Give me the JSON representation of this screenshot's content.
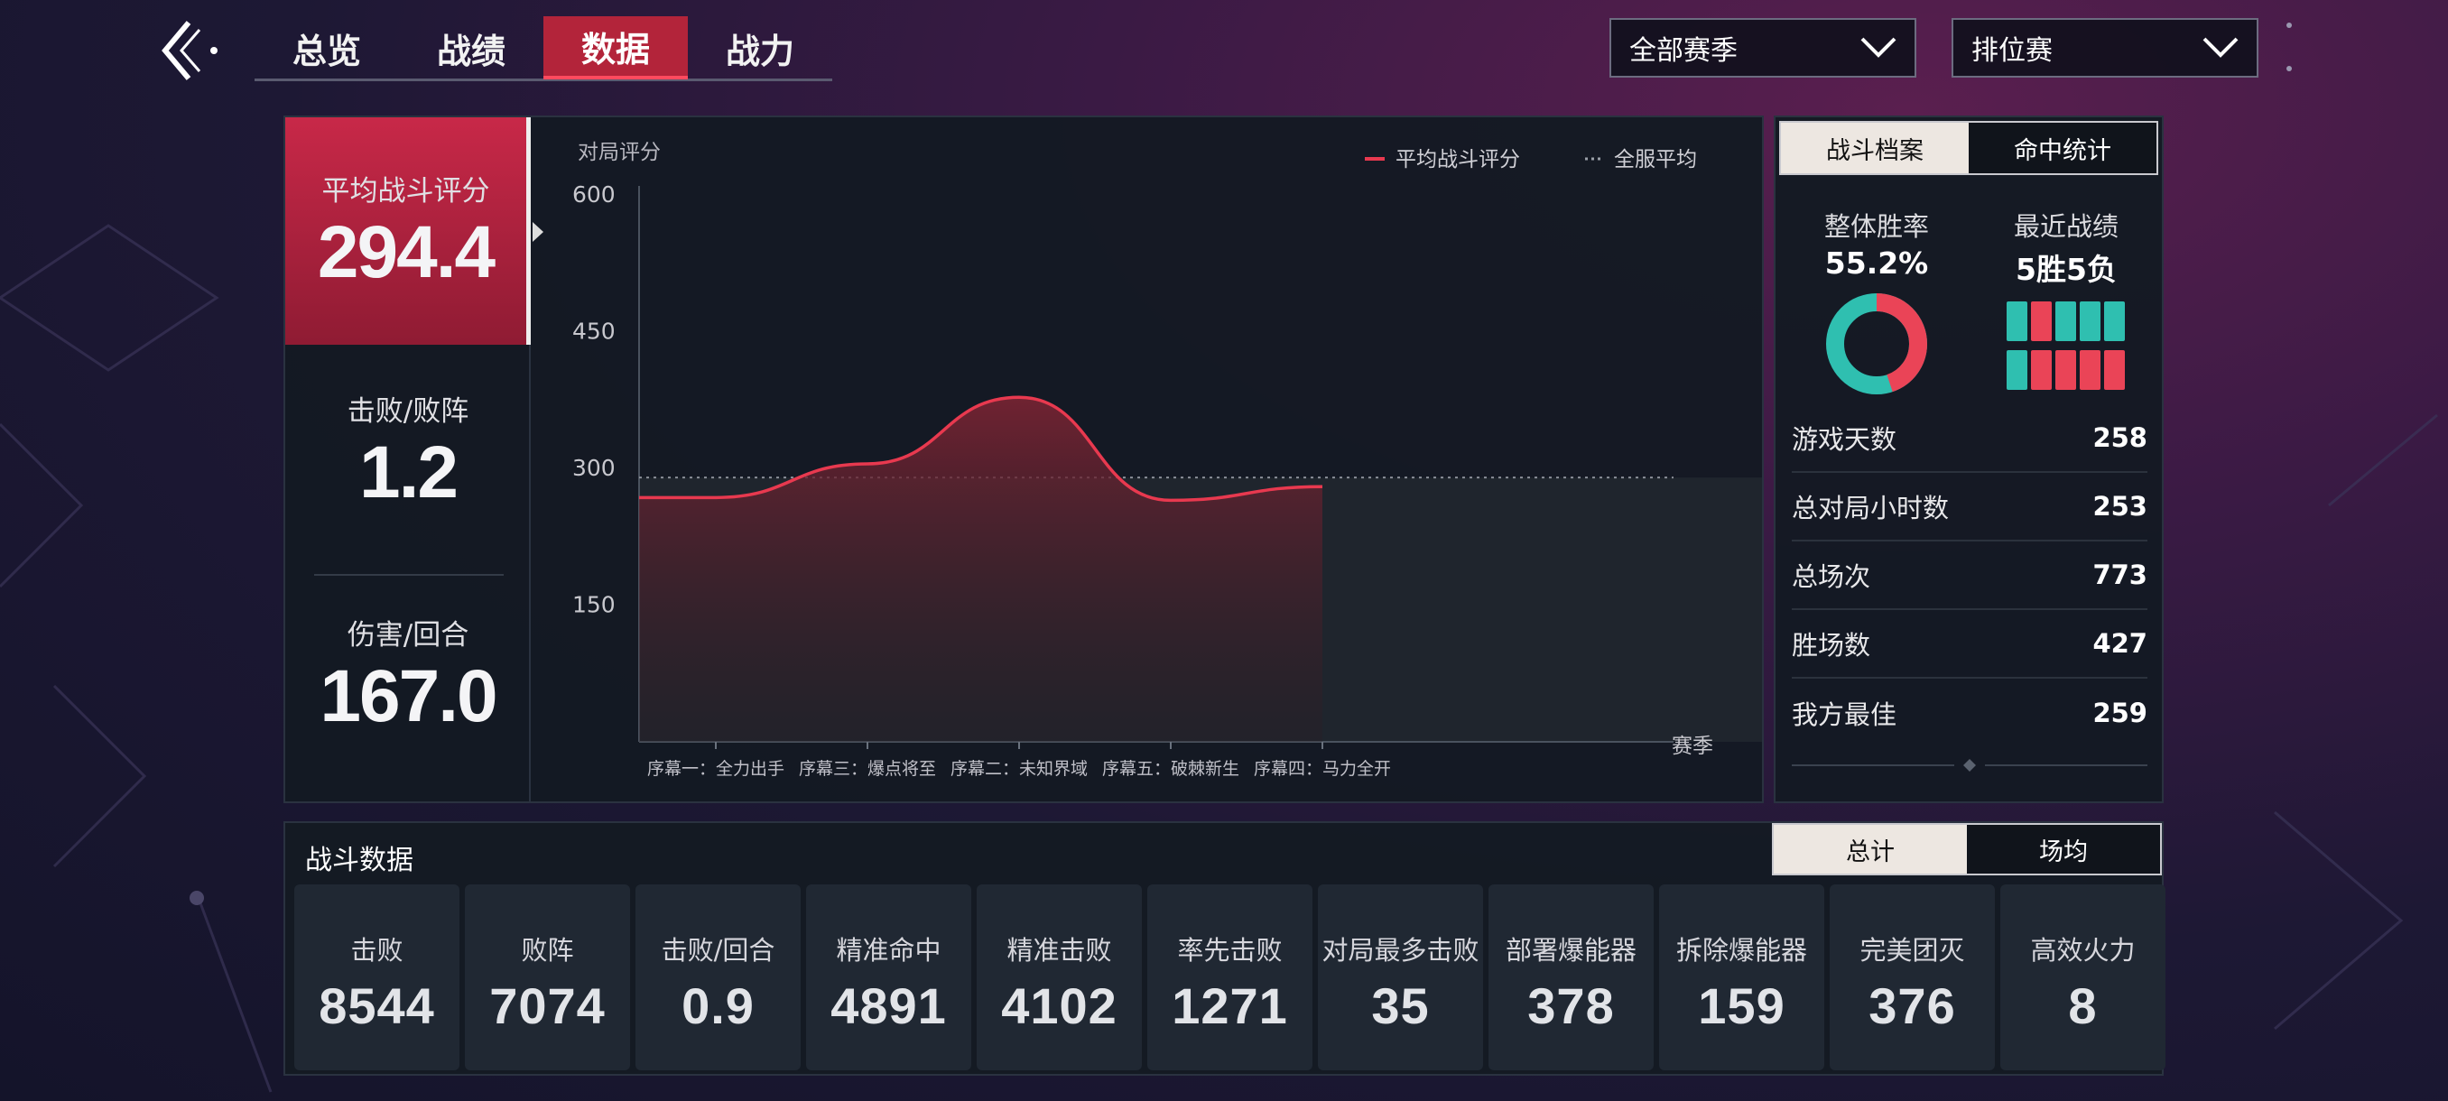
{
  "nav": {
    "tabs": [
      {
        "label": "总览"
      },
      {
        "label": "战绩"
      },
      {
        "label": "数据"
      },
      {
        "label": "战力"
      }
    ],
    "active_tab": 2,
    "season_dropdown": "全部赛季",
    "mode_dropdown": "排位赛"
  },
  "left_stats": {
    "avg_rating": {
      "label": "平均战斗评分",
      "value": "294.4"
    },
    "kd": {
      "label": "击败/败阵",
      "value": "1.2"
    },
    "dmg": {
      "label": "伤害/回合",
      "value": "167.0"
    }
  },
  "chart_data": {
    "type": "area",
    "ylabel": "对局评分",
    "xlabel": "赛季",
    "yticks": [
      600,
      450,
      300,
      150
    ],
    "ylim": [
      0,
      600
    ],
    "categories": [
      "序幕一：全力出手",
      "序幕三：爆点将至",
      "序幕二：未知界域",
      "序幕五：破棘新生",
      "序幕四：马力全开"
    ],
    "series": [
      {
        "name": "平均战斗评分",
        "values": [
          268,
          305,
          378,
          265,
          280
        ],
        "color": "#e8394f"
      }
    ],
    "reference": {
      "name": "全服平均",
      "value": 290
    },
    "legend": "top-right"
  },
  "profile": {
    "tabs": [
      "战斗档案",
      "命中统计"
    ],
    "winrate_label": "整体胜率",
    "winrate": "55.2%",
    "winrate_value": 0.552,
    "recent_label": "最近战绩",
    "recent": "5胜5负",
    "recent_results": [
      "W",
      "L",
      "W",
      "W",
      "W",
      "W",
      "L",
      "L",
      "L",
      "L"
    ],
    "colors": {
      "win": "#2fbfb0",
      "loss": "#ea4457"
    },
    "rows": [
      {
        "k": "游戏天数",
        "v": "258"
      },
      {
        "k": "总对局小时数",
        "v": "253"
      },
      {
        "k": "总场次",
        "v": "773"
      },
      {
        "k": "胜场数",
        "v": "427"
      },
      {
        "k": "我方最佳",
        "v": "259"
      }
    ]
  },
  "combat": {
    "title": "战斗数据",
    "tabs": [
      "总计",
      "场均"
    ],
    "tiles": [
      {
        "label": "击败",
        "value": "8544"
      },
      {
        "label": "败阵",
        "value": "7074"
      },
      {
        "label": "击败/回合",
        "value": "0.9"
      },
      {
        "label": "精准命中",
        "value": "4891"
      },
      {
        "label": "精准击败",
        "value": "4102"
      },
      {
        "label": "率先击败",
        "value": "1271"
      },
      {
        "label": "对局最多击败",
        "value": "35"
      },
      {
        "label": "部署爆能器",
        "value": "378"
      },
      {
        "label": "拆除爆能器",
        "value": "159"
      },
      {
        "label": "完美团灭",
        "value": "376"
      },
      {
        "label": "高效火力",
        "value": "8"
      }
    ]
  }
}
